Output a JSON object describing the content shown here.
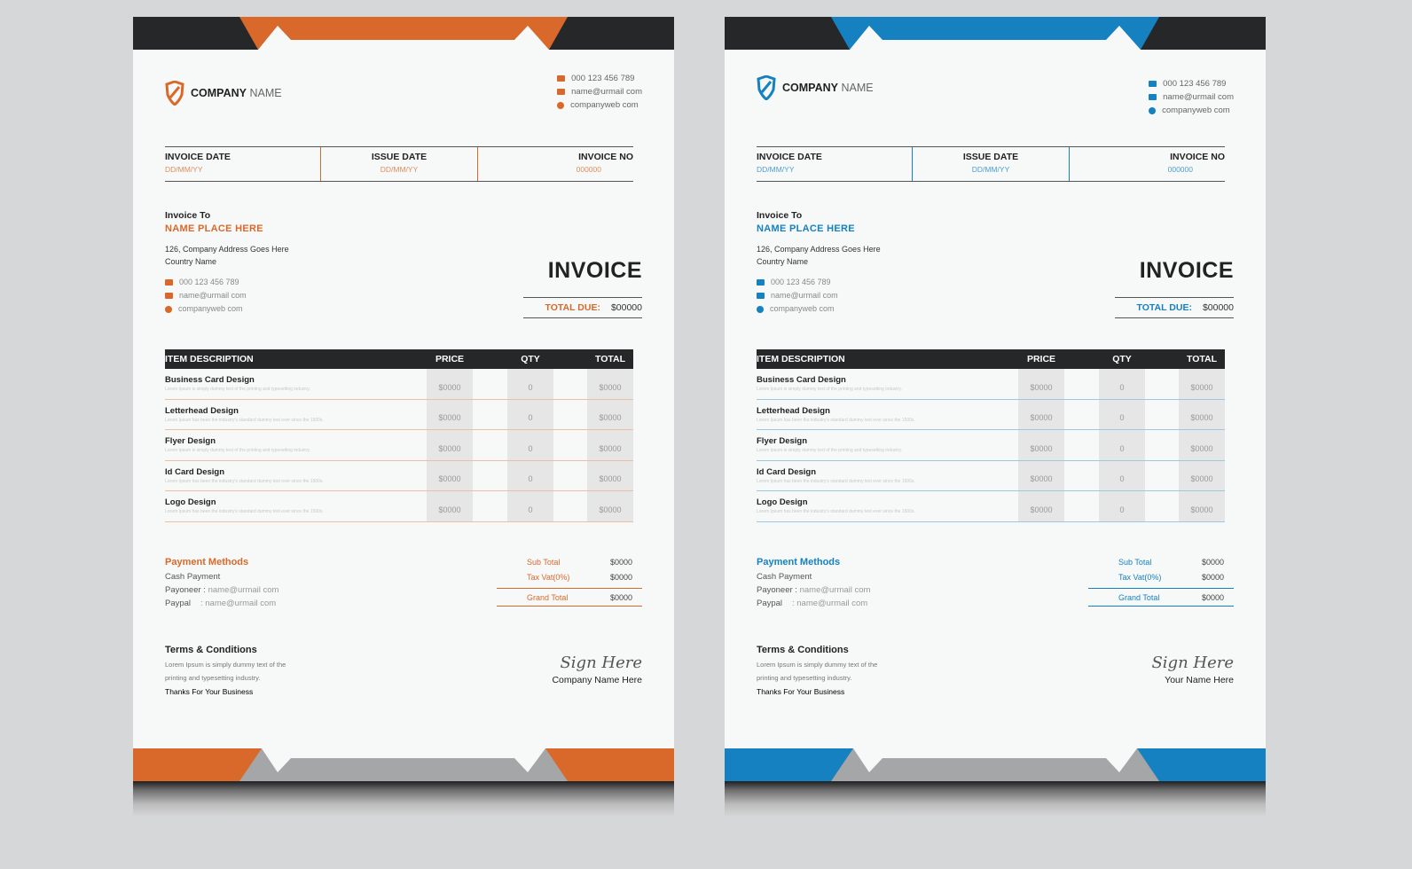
{
  "colors": {
    "orange": "#d9692a",
    "blue": "#1581c1",
    "dark": "#262729",
    "gray": "#a5a6a7"
  },
  "invoices": [
    {
      "theme": "orange",
      "logo": {
        "bold": "COMPANY",
        "light": "NAME",
        "icon": "shield-icon"
      },
      "contact": {
        "phone": "000 123 456 789",
        "email": "name@urmail com",
        "web": "companyweb com"
      },
      "dates": {
        "invoice_date_label": "INVOICE DATE",
        "invoice_date_value": "DD/MM/YY",
        "issue_date_label": "ISSUE DATE",
        "issue_date_value": "DD/MM/YY",
        "invoice_no_label": "INVOICE NO",
        "invoice_no_value": "000000"
      },
      "bill_to": {
        "heading": "Invoice To",
        "name": "NAME PLACE HERE",
        "address_line1": "126, Company Address Goes Here",
        "address_line2": "Country Name",
        "phone": "000 123 456 789",
        "email": "name@urmail com",
        "web": "companyweb com"
      },
      "title": "INVOICE",
      "total_due": {
        "label": "TOTAL DUE:",
        "value": "$00000"
      },
      "table": {
        "headers": {
          "desc": "ITEM DESCRIPTION",
          "price": "PRICE",
          "qty": "QTY",
          "total": "TOTAL"
        },
        "rows": [
          {
            "name": "Business Card Design",
            "sub": "Lorem Ipsum is simply dummy text of the printing and typesetting industry.",
            "price": "$0000",
            "qty": "0",
            "total": "$0000"
          },
          {
            "name": "Letterhead Design",
            "sub": "Lorem Ipsum has been the industry's standard dummy text ever since the 1500s.",
            "price": "$0000",
            "qty": "0",
            "total": "$0000"
          },
          {
            "name": "Flyer Design",
            "sub": "Lorem Ipsum is simply dummy text of the printing and typesetting industry.",
            "price": "$0000",
            "qty": "0",
            "total": "$0000"
          },
          {
            "name": "Id Card Design",
            "sub": "Lorem Ipsum has been the industry's standard dummy text ever since the 1500s.",
            "price": "$0000",
            "qty": "0",
            "total": "$0000"
          },
          {
            "name": "Logo Design",
            "sub": "Lorem Ipsum has been the industry's standard dummy text ever since the 1500s.",
            "price": "$0000",
            "qty": "0",
            "total": "$0000"
          }
        ]
      },
      "payment": {
        "heading": "Payment Methods",
        "cash": "Cash Payment",
        "payoneer_label": "Payoneer :",
        "payoneer_value": "name@urmail com",
        "paypal_label": "Paypal",
        "paypal_value": ": name@urmail com"
      },
      "summary": {
        "subtotal_label": "Sub Total",
        "subtotal_value": "$0000",
        "tax_label": "Tax Vat(0%)",
        "tax_value": "$0000",
        "grand_label": "Grand Total",
        "grand_value": "$0000"
      },
      "terms": {
        "heading": "Terms & Conditions",
        "line1": "Lorem Ipsum is simply dummy text of the",
        "line2": "printing and typesetting industry.",
        "thanks": "Thanks For Your Business"
      },
      "signature": {
        "script": "Sign Here",
        "name": "Company Name Here"
      }
    },
    {
      "theme": "blue",
      "logo": {
        "bold": "COMPANY",
        "light": "NAME",
        "icon": "shield-icon"
      },
      "contact": {
        "phone": "000 123 456 789",
        "email": "name@urmail com",
        "web": "companyweb com"
      },
      "dates": {
        "invoice_date_label": "INVOICE DATE",
        "invoice_date_value": "DD/MM/YY",
        "issue_date_label": "ISSUE DATE",
        "issue_date_value": "DD/MM/YY",
        "invoice_no_label": "INVOICE NO",
        "invoice_no_value": "000000"
      },
      "bill_to": {
        "heading": "Invoice To",
        "name": "NAME PLACE HERE",
        "address_line1": "126, Company Address Goes Here",
        "address_line2": "Country Name",
        "phone": "000 123 456 789",
        "email": "name@urmail com",
        "web": "companyweb com"
      },
      "title": "INVOICE",
      "total_due": {
        "label": "TOTAL DUE:",
        "value": "$00000"
      },
      "table": {
        "headers": {
          "desc": "ITEM DESCRIPTION",
          "price": "PRICE",
          "qty": "QTY",
          "total": "TOTAL"
        },
        "rows": [
          {
            "name": "Business Card Design",
            "sub": "Lorem Ipsum is simply dummy text of the printing and typesetting industry.",
            "price": "$0000",
            "qty": "0",
            "total": "$0000"
          },
          {
            "name": "Letterhead Design",
            "sub": "Lorem Ipsum has been the industry's standard dummy text ever since the 1500s.",
            "price": "$0000",
            "qty": "0",
            "total": "$0000"
          },
          {
            "name": "Flyer Design",
            "sub": "Lorem Ipsum is simply dummy text of the printing and typesetting industry.",
            "price": "$0000",
            "qty": "0",
            "total": "$0000"
          },
          {
            "name": "Id Card Design",
            "sub": "Lorem Ipsum has been the industry's standard dummy text ever since the 1500s.",
            "price": "$0000",
            "qty": "0",
            "total": "$0000"
          },
          {
            "name": "Logo Design",
            "sub": "Lorem Ipsum has been the industry's standard dummy text ever since the 1500s.",
            "price": "$0000",
            "qty": "0",
            "total": "$0000"
          }
        ]
      },
      "payment": {
        "heading": "Payment Methods",
        "cash": "Cash Payment",
        "payoneer_label": "Payoneer :",
        "payoneer_value": "name@urmail com",
        "paypal_label": "Paypal",
        "paypal_value": ": name@urmail com"
      },
      "summary": {
        "subtotal_label": "Sub Total",
        "subtotal_value": "$0000",
        "tax_label": "Tax Vat(0%)",
        "tax_value": "$0000",
        "grand_label": "Grand Total",
        "grand_value": "$0000"
      },
      "terms": {
        "heading": "Terms & Conditions",
        "line1": "Lorem Ipsum is simply dummy text of the",
        "line2": "printing and typesetting industry.",
        "thanks": "Thanks For Your Business"
      },
      "signature": {
        "script": "Sign Here",
        "name": "Your Name Here"
      }
    }
  ]
}
